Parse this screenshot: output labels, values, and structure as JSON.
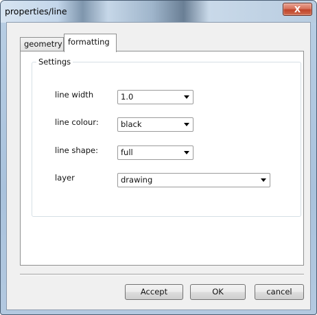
{
  "window": {
    "title": "properties/line",
    "close_label": "X"
  },
  "tabs": [
    {
      "label": "geometry",
      "selected": false
    },
    {
      "label": "formatting",
      "selected": true
    }
  ],
  "settings": {
    "group_label": "Settings",
    "fields": [
      {
        "label": "line width",
        "value": "1.0"
      },
      {
        "label": "line colour:",
        "value": "black"
      },
      {
        "label": "line shape:",
        "value": "full"
      },
      {
        "label": "layer",
        "value": "drawing"
      }
    ]
  },
  "buttons": {
    "accept": "Accept",
    "ok": "OK",
    "cancel": "cancel"
  }
}
